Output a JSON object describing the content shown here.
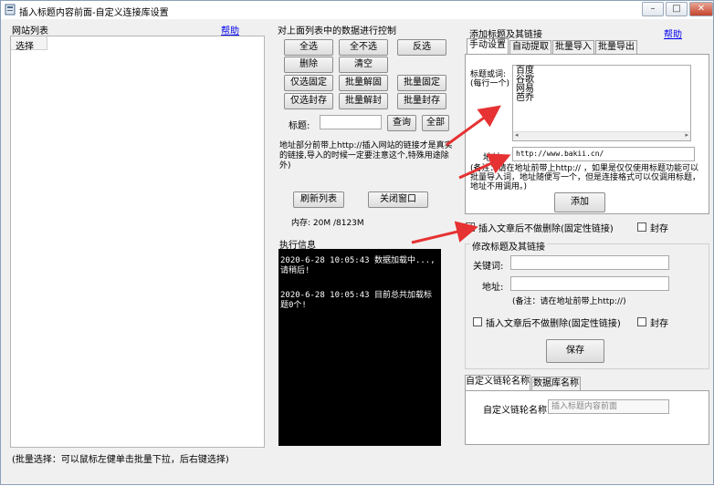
{
  "window": {
    "title": "插入标题内容前面-自定义连接库设置"
  },
  "title_controls": {
    "minimize": "–",
    "maximize": "□",
    "close": "✕"
  },
  "left": {
    "group_label": "网站列表",
    "help": "帮助",
    "column_header": "选择",
    "footer": "(批量选择：可以鼠标左健单击批量下拉，后右键选择)"
  },
  "middle": {
    "group_label": "对上面列表中的数据进行控制",
    "buttons": [
      "全选",
      "全不选",
      "反选",
      "删除",
      "清空",
      "仅选固定",
      "批量解固",
      "批量固定",
      "仅选封存",
      "批量解封",
      "批量封存"
    ],
    "search_label": "标题:",
    "search_value": "",
    "query_button": "查询",
    "all_button": "全部",
    "note": "地址部分前带上http://插入网站的链接才是真实的链接,导入的时候一定要注意这个,特殊用途除外)",
    "refresh_button": "刷新列表",
    "close_button": "关闭窗口",
    "memory": "内存: 20M /8123M",
    "log_label": "执行信息",
    "log_lines": [
      "2020-6-28 10:05:43  数据加载中...,请稍后!",
      "2020-6-28 10:05:43  目前总共加载标题0个!"
    ]
  },
  "right": {
    "add_group_label": "添加标题及其链接",
    "help": "帮助",
    "tabs": [
      "手动设置",
      "自动提取",
      "批量导入",
      "批量导出"
    ],
    "keyword_label": "标题或词:",
    "keyword_hint": "(每行一个)",
    "keywords": [
      "百度",
      "谷歌",
      "网易",
      "芭乔"
    ],
    "address_label": "地址:",
    "address_value": "http://www.bakii.cn/",
    "note": "(备注：请在地址前带上http:// ，如果是仅仅使用标题功能可以批量导入词，地址随便写一个，但是连接格式可以仅调用标题，地址不用调用。)",
    "add_button": "添加",
    "insert_check_label": "插入文章后不做删除(固定性链接)",
    "insert_checked": true,
    "archive_label": "封存",
    "modify_group_label": "修改标题及其链接",
    "mod_keyword_label": "关键词:",
    "mod_address_label": "地址:",
    "mod_note": "(备注：请在地址前带上http://)",
    "mod_insert_label": "插入文章后不做删除(固定性链接)",
    "mod_archive_label": "封存",
    "save_button": "保存",
    "bottom_tabs": [
      "自定义链轮名称",
      "数据库名称"
    ],
    "custom_name_label": "自定义链轮名称:",
    "custom_name_placeholder": "插入标题内容前面"
  },
  "colors": {
    "arrow": "#e63232",
    "log_bg": "#000000",
    "link": "#0000ee"
  }
}
